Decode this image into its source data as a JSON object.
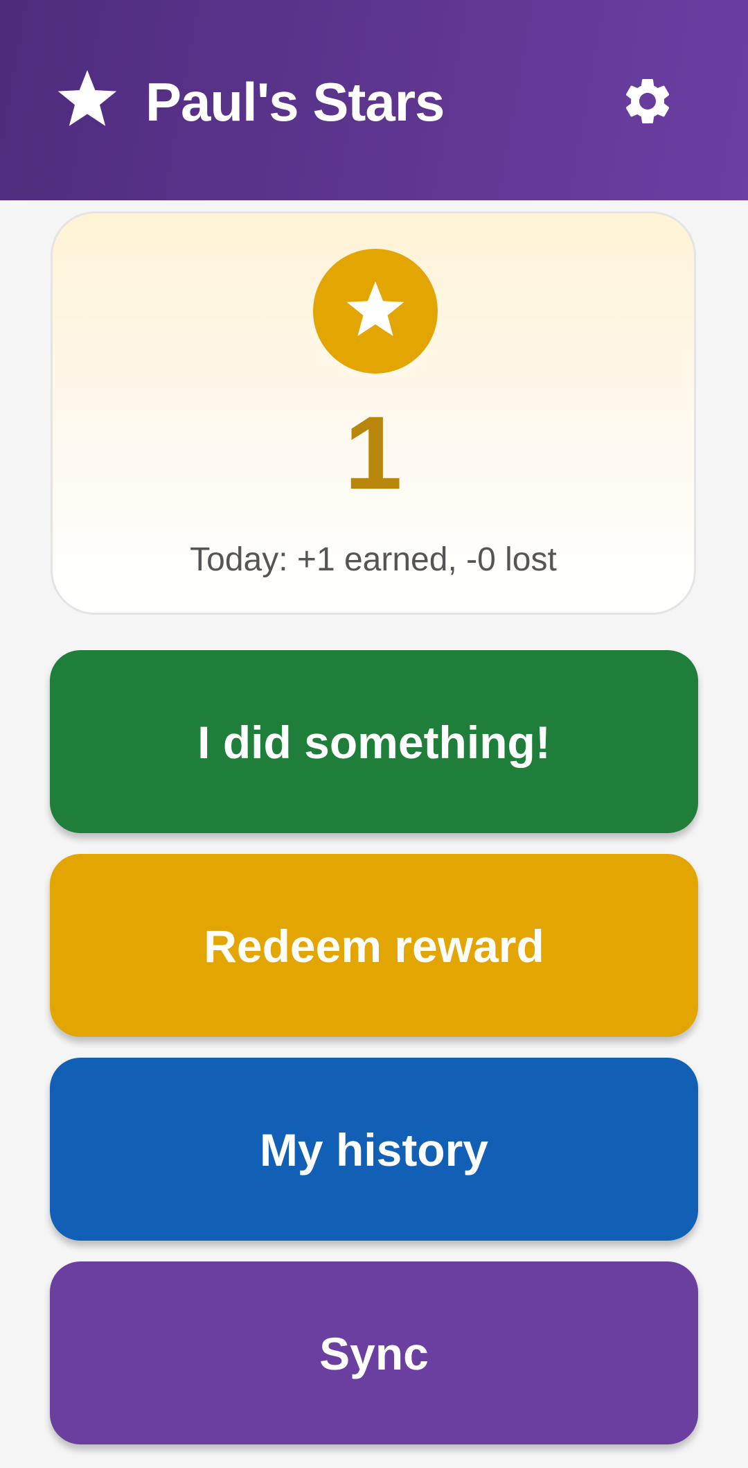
{
  "header": {
    "title": "Paul's Stars",
    "icon": "star-icon",
    "settings_icon": "gear-icon"
  },
  "star_card": {
    "badge_icon": "star-icon",
    "count": "1",
    "today_summary": "Today: +1 earned, -0 lost"
  },
  "actions": {
    "did_something": "I did something!",
    "redeem_reward": "Redeem reward",
    "my_history": "My history",
    "sync": "Sync"
  },
  "colors": {
    "header_gradient_start": "#4f2c7e",
    "header_gradient_end": "#6b3fa3",
    "green": "#1e7e3a",
    "gold": "#e3a502",
    "blue": "#1260b5",
    "purple": "#6a3fa0",
    "count_text": "#b8860b",
    "background": "#f5f5f5"
  }
}
